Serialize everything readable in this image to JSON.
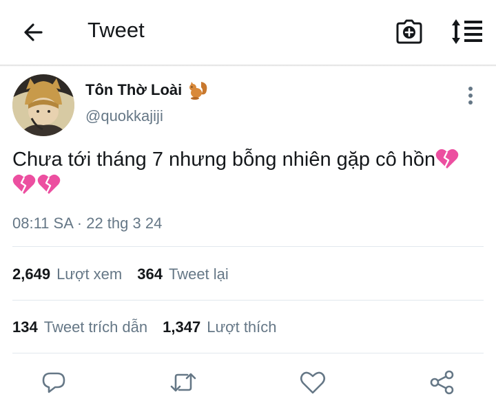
{
  "header": {
    "title": "Tweet",
    "back_icon": "arrow-left-icon",
    "camera_icon": "camera-add-icon",
    "sort_icon": "sort-list-icon"
  },
  "tweet": {
    "author_name": "Tôn Thờ Loài",
    "author_emoji_icon": "squirrel-icon",
    "author_handle": "@quokkajiji",
    "text": "Chưa tới tháng 7 nhưng bỗng nhiên gặp cô hồn",
    "text_emoji_icon": "broken-heart-icon",
    "text_emoji_count": 3,
    "timestamp": "08:11 SA · 22 thg 3 24"
  },
  "stats": {
    "views_count": "2,649",
    "views_label": "Lượt xem",
    "retweets_count": "364",
    "retweets_label": "Tweet lại",
    "quotes_count": "134",
    "quotes_label": "Tweet trích dẫn",
    "likes_count": "1,347",
    "likes_label": "Lượt thích"
  },
  "actions": [
    "reply-icon",
    "retweet-icon",
    "like-icon",
    "share-icon"
  ],
  "colors": {
    "text": "#14171a",
    "secondary": "#657786",
    "icon": "#657786",
    "divider": "#e1e8ed",
    "broken_heart": "#ec4fa0"
  }
}
